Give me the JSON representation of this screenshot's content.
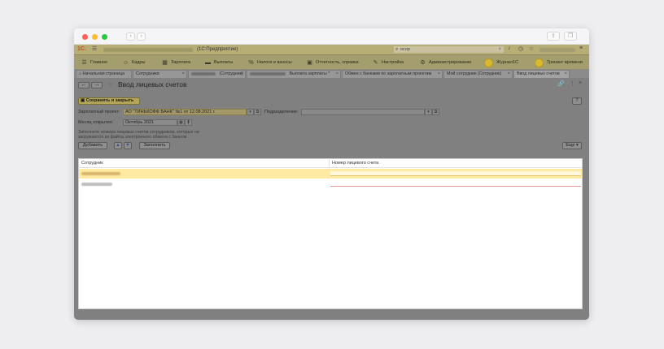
{
  "window": {
    "nav_back": "‹",
    "nav_forward": "›",
    "share_icon": "share-icon",
    "tabs_icon": "tabs-icon"
  },
  "topbar": {
    "logo": "1С.",
    "app_name": "(1С:Предприятие)",
    "search_value": "осор",
    "search_clear": "×"
  },
  "main_menu": [
    {
      "icon": "☰",
      "label": "Главное"
    },
    {
      "icon": "☺",
      "label": "Кадры"
    },
    {
      "icon": "▦",
      "label": "Зарплата"
    },
    {
      "icon": "▬",
      "label": "Выплаты"
    },
    {
      "icon": "%",
      "label": "Налоги и взносы"
    },
    {
      "icon": "▣",
      "label": "Отчетность, справки"
    },
    {
      "icon": "✎",
      "label": "Настройка"
    },
    {
      "icon": "⚙",
      "label": "Администрирование"
    },
    {
      "icon": "",
      "label": "Журнал1С"
    },
    {
      "icon": "",
      "label": "Тренинг времени"
    }
  ],
  "tabs": [
    {
      "label": "Начальная страница",
      "icon": "⌂"
    },
    {
      "label": "Сотрудники"
    },
    {
      "label": "(Сотрудник)"
    },
    {
      "label": "Выплата зарплаты *"
    },
    {
      "label": "Обмен с банками по зарплатным проектам"
    },
    {
      "label": "Мой сотрудник (Сотрудник)"
    },
    {
      "label": "Ввод лицевых счетов"
    }
  ],
  "tab_close": "×",
  "form": {
    "title": "Ввод лицевых счетов",
    "save_close": "Сохранить и закрыть",
    "help": "?",
    "salary_project_label": "Зарплатный проект:",
    "salary_project_value": "АО \"ТИНЬКОФФ БАНК\" №1 от 12.08.2021 г.",
    "subdivision_label": "Подразделение:",
    "subdivision_value": "",
    "month_label": "Месяц открытия:",
    "month_value": "Октябрь 2021",
    "hint": "Заполните номера лицевых счетов сотрудников, которые не загружаются из файла электронного обмена с банком.",
    "add_button": "Добавить",
    "up": "▲",
    "down": "▼",
    "fill_button": "Заполнить",
    "more_button": "Еще ▾"
  },
  "table": {
    "columns": [
      "Сотрудник",
      "Номер лицевого счета"
    ]
  }
}
